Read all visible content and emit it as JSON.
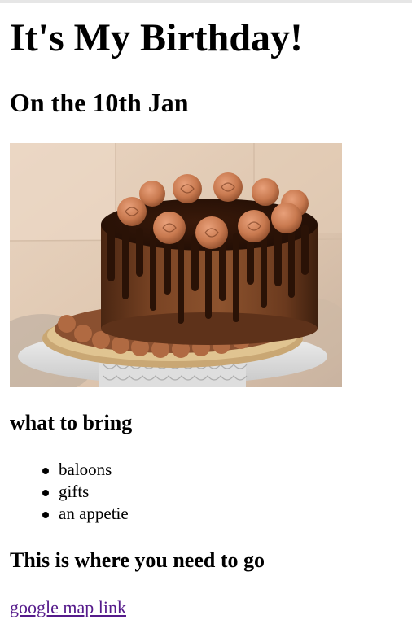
{
  "page": {
    "title": "It's My Birthday!",
    "subtitle": "On the 10th Jan"
  },
  "image": {
    "alt": "chocolate-drip-cake-photo",
    "icon": "cake-photo"
  },
  "bring_section": {
    "heading": "what to bring",
    "items": [
      "baloons",
      "gifts",
      "an appetie"
    ]
  },
  "directions": {
    "heading": "This is where you need to go",
    "link_text": "google map link",
    "link_color": "#551a8b"
  },
  "colors": {
    "text": "#000000",
    "background": "#ffffff",
    "visited_link": "#551a8b"
  }
}
